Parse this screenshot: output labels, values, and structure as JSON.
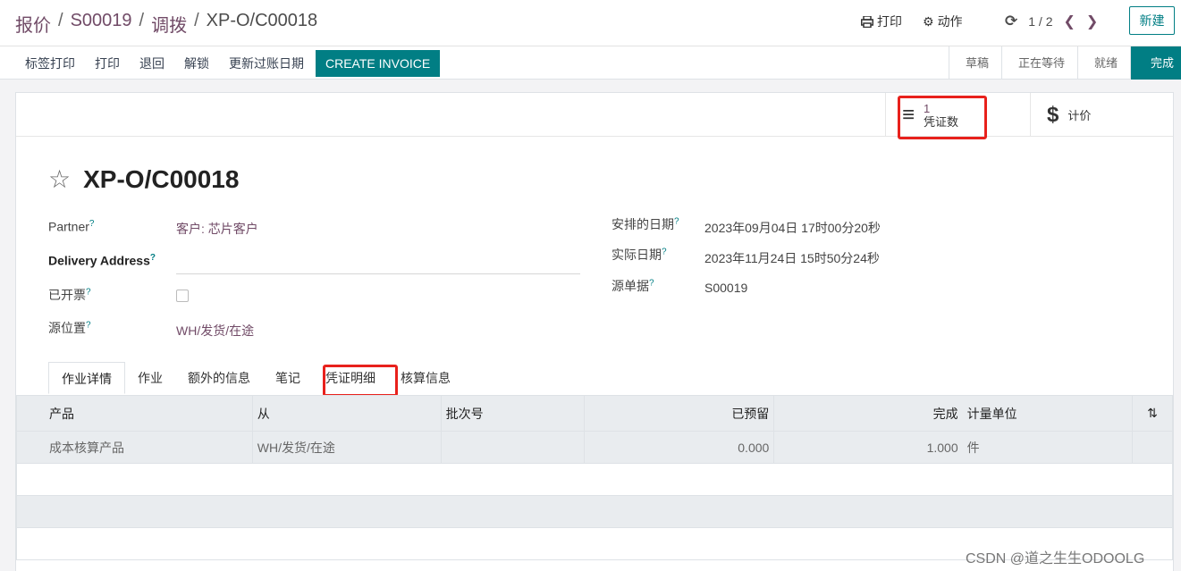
{
  "breadcrumb": {
    "part1": "报价",
    "part2": "S00019",
    "part3": "调拨",
    "current": "XP-O/C00018"
  },
  "header_actions": {
    "print": "打印",
    "action": "动作"
  },
  "pager": {
    "value": "1 / 2"
  },
  "new_button": "新建",
  "toolbar": {
    "label_print": "标签打印",
    "print": "打印",
    "return": "退回",
    "unlock": "解锁",
    "update_date": "更新过账日期",
    "create_invoice": "CREATE INVOICE"
  },
  "statusbar": {
    "draft": "草稿",
    "waiting": "正在等待",
    "ready": "就绪",
    "done": "完成"
  },
  "smart_buttons": {
    "voucher_count": "1",
    "voucher_label": "凭证数",
    "valuation_label": "计价"
  },
  "record": {
    "name": "XP-O/C00018"
  },
  "fields": {
    "partner_label": "Partner",
    "partner_value": "客户: 芯片客户",
    "delivery_label": "Delivery Address",
    "invoiced_label": "已开票",
    "source_location_label": "源位置",
    "source_location_value": "WH/发货/在途",
    "scheduled_label": "安排的日期",
    "scheduled_value": "2023年09月04日 17时00分20秒",
    "actual_label": "实际日期",
    "actual_value": "2023年11月24日 15时50分24秒",
    "origin_label": "源单据",
    "origin_value": "S00019",
    "help_mark": "?"
  },
  "tabs": [
    "作业详情",
    "作业",
    "额外的信息",
    "笔记",
    "凭证明细",
    "核算信息"
  ],
  "table": {
    "headers": {
      "product": "产品",
      "from": "从",
      "lot": "批次号",
      "reserved": "已预留",
      "done": "完成",
      "uom": "计量单位"
    },
    "rows": [
      {
        "product": "成本核算产品",
        "from": "WH/发货/在途",
        "lot": "",
        "reserved": "0.000",
        "done": "1.000",
        "uom": "件"
      }
    ]
  },
  "watermark": "CSDN @道之生生ODOOLG",
  "colors": {
    "primary": "#017e84",
    "link": "#714b67",
    "highlight": "#e8211c"
  }
}
